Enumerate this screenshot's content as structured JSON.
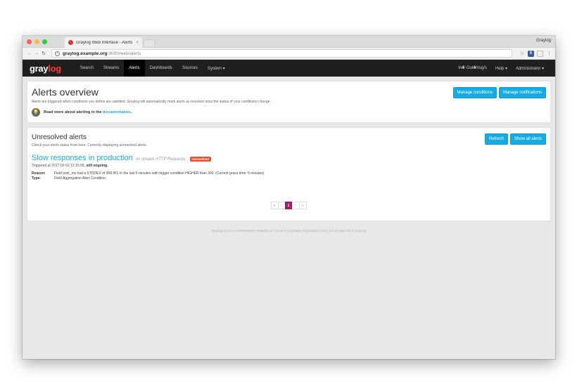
{
  "browser": {
    "tab_title": "Graylog Web Interface - Alerts",
    "tab_close": "×",
    "profile": "Graylog",
    "url_host": "graylog.example.org",
    "url_rest": ":9000/web/alerts",
    "ext_label": "B"
  },
  "navbar": {
    "logo_main": "gray",
    "logo_accent": "log",
    "items": [
      "Search",
      "Streams",
      "Alerts",
      "Dashboards",
      "Sources",
      "System ▾"
    ],
    "active_item": "Alerts",
    "throughput_in_label": "In ",
    "throughput_in": "4",
    "throughput_mid": " / Out ",
    "throughput_out": "4",
    "throughput_unit": " msg/s",
    "help": "Help ▾",
    "user": "Administrator ▾"
  },
  "overview": {
    "title": "Alerts overview",
    "description": "Alerts are triggered when conditions you define are satisfied. Graylog will automatically mark alerts as resolved once the status of your conditions change.",
    "doc_prefix": "Read more about alerting in the ",
    "doc_link": "documentation",
    "doc_suffix": ".",
    "manage_conditions": "Manage conditions",
    "manage_notifications": "Manage notifications"
  },
  "unresolved": {
    "title": "Unresolved alerts",
    "description": "Check your alerts status from here. Currently displaying unresolved alerts.",
    "refresh": "Refresh",
    "show_all": "Show all alerts",
    "alert": {
      "name": "Slow responses in production",
      "stream_prefix": "on stream ",
      "stream_name": "HTTP Requests",
      "badge": "Unresolved",
      "triggered_prefix": "Triggered at 2017-02-02 12:15:58, ",
      "triggered_status": "still ongoing.",
      "reason_label": "Reason:",
      "reason": "Field took_ms had a STDDEV of 358.951 in the last 5 minutes with trigger condition HIGHER than 300. (Current grace time: 5 minutes)",
      "type_label": "Type:",
      "type": "Field Aggregation Alert Condition"
    },
    "pagination": [
      "«",
      "‹",
      "1",
      "›",
      "»"
    ],
    "current_page": "1"
  },
  "footer": "Graylog 2.2.0-rc.2-SNAPSHOT+9b9cf11 on 172.16.0.14 (Oracle Corporation 1.8.0_112 on Mac OS X 10.12.3)"
}
